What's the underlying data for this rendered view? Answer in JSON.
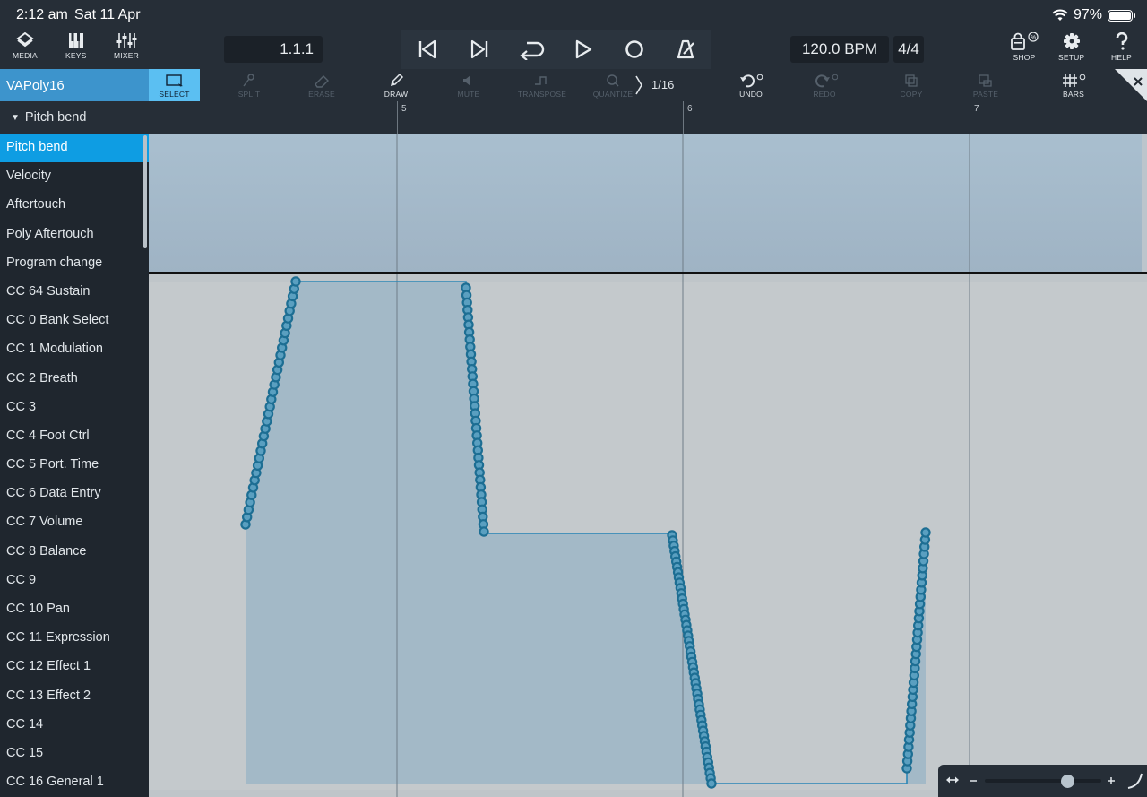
{
  "status_bar": {
    "time": "2:12 am",
    "date": "Sat 11 Apr",
    "battery": "97%"
  },
  "toolbar": {
    "media_label": "MEDIA",
    "keys_label": "KEYS",
    "mixer_label": "MIXER",
    "position": "1.1.1",
    "tempo": "120.0 BPM",
    "time_signature": "4/4",
    "shop_label": "SHOP",
    "setup_label": "SETUP",
    "help_label": "HELP"
  },
  "edit_bar": {
    "track_name": "VAPoly16",
    "tools": {
      "select": "SELECT",
      "split": "SPLIT",
      "erase": "ERASE",
      "draw": "DRAW",
      "mute": "MUTE",
      "transpose": "TRANSPOSE",
      "quantize": "QUANTIZE",
      "undo": "UNDO",
      "redo": "REDO",
      "copy": "COPY",
      "paste": "PASTE",
      "bars": "BARS"
    },
    "quantize_value": "1/16"
  },
  "sidebar": {
    "header": "Pitch bend",
    "items": [
      "Pitch bend",
      "Velocity",
      "Aftertouch",
      "Poly Aftertouch",
      "Program change",
      "CC 64 Sustain",
      "CC 0 Bank Select",
      "CC 1 Modulation",
      "CC 2 Breath",
      "CC 3",
      "CC 4 Foot Ctrl",
      "CC 5 Port. Time",
      "CC 6 Data Entry",
      "CC 7 Volume",
      "CC 8 Balance",
      "CC 9",
      "CC 10 Pan",
      "CC 11 Expression",
      "CC 12 Effect 1",
      "CC 13 Effect 2",
      "CC 14",
      "CC 15",
      "CC 16 General 1"
    ],
    "active_index": 0
  },
  "ruler": {
    "bars": [
      "5",
      "6",
      "7"
    ]
  },
  "colors": {
    "accent": "#0e9de3",
    "point": "#1d6e93",
    "fill": "#a3b9c7",
    "lane": "#c4c9cc"
  }
}
